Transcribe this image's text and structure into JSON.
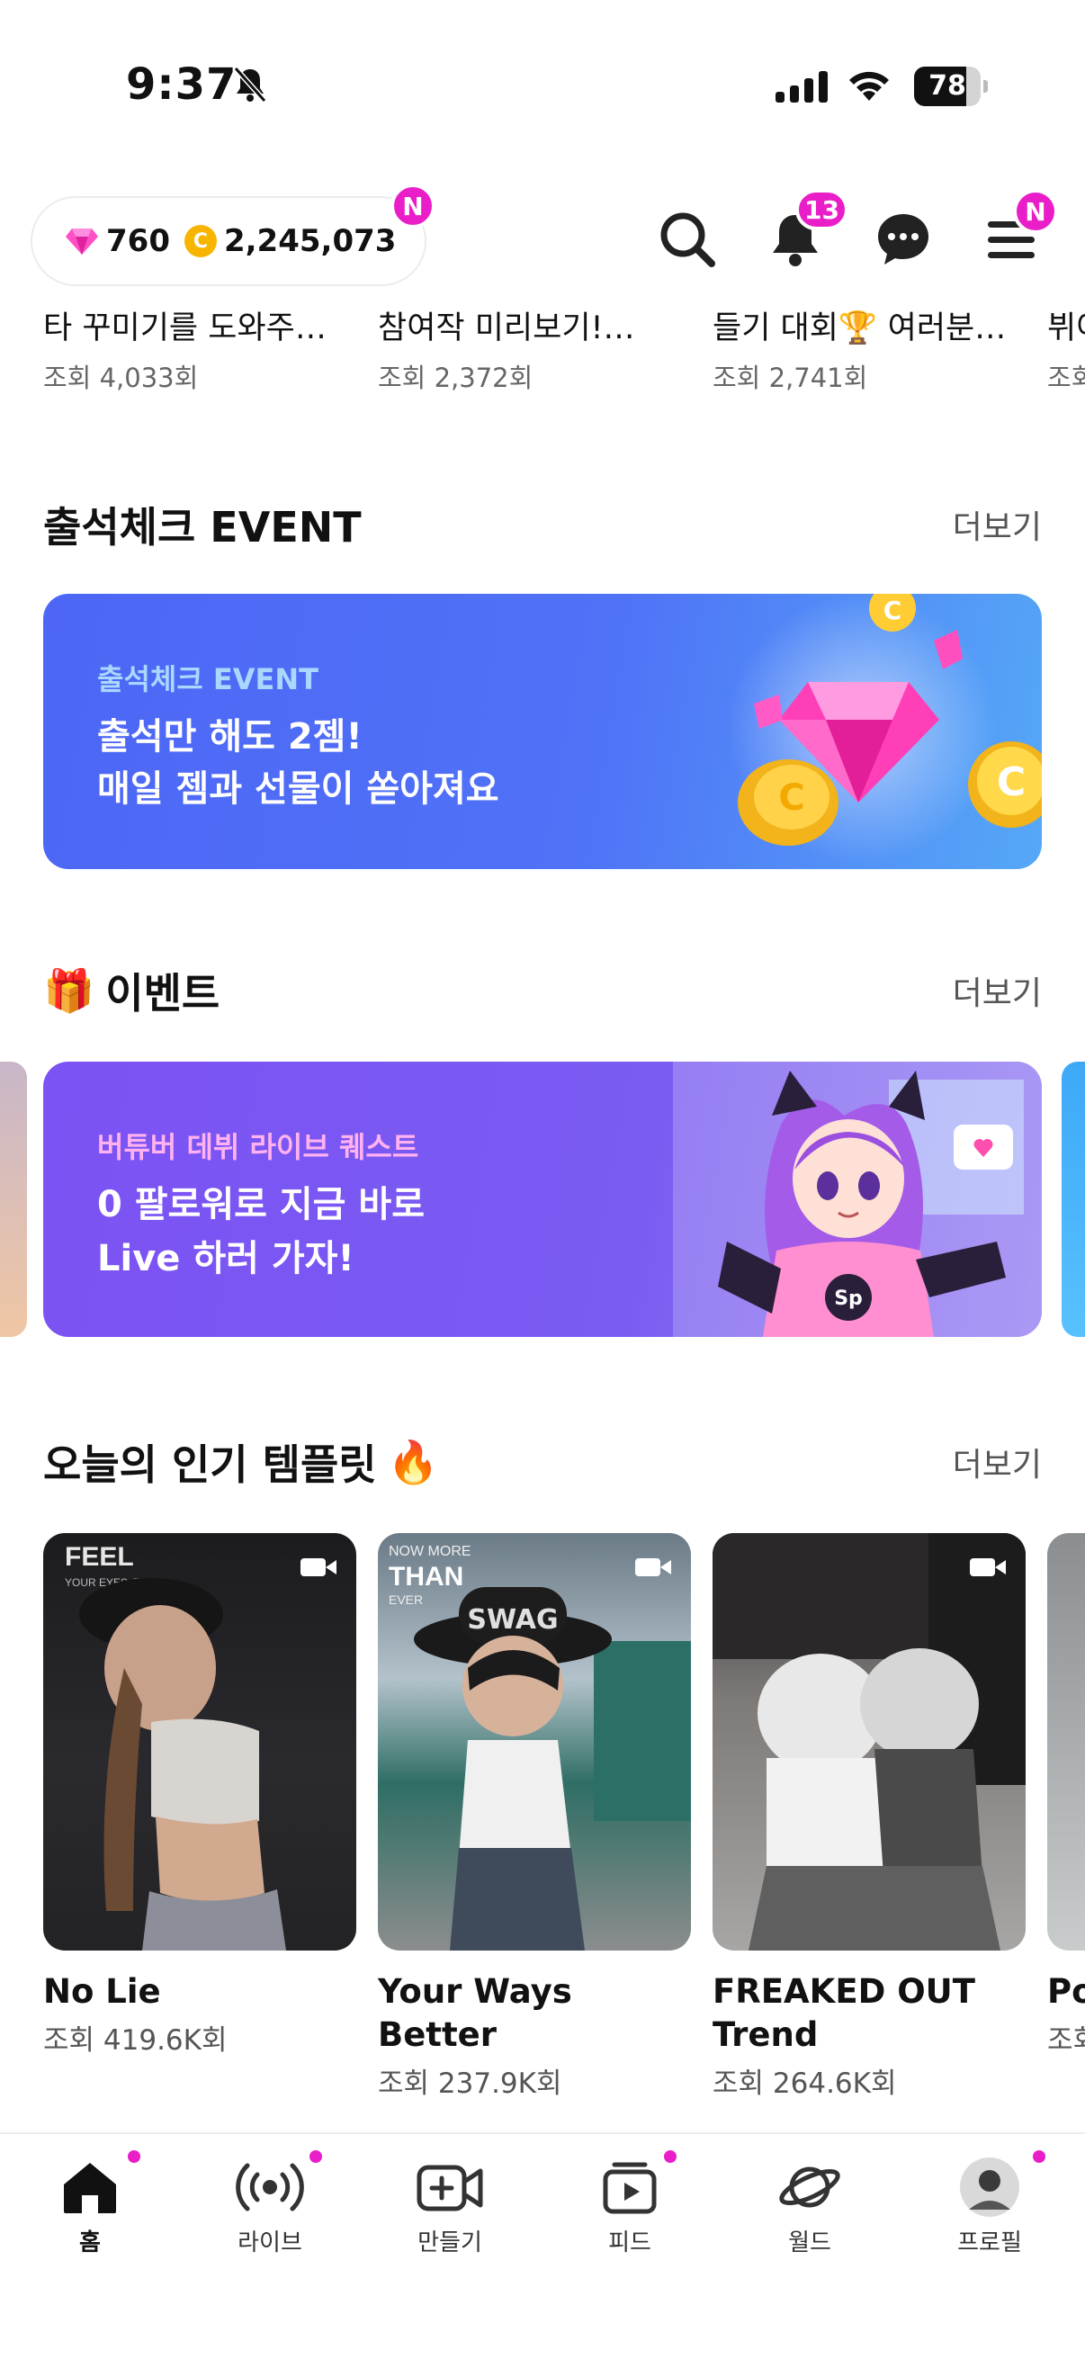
{
  "status_bar": {
    "time": "9:37",
    "battery": "78",
    "battery_level": 0.78
  },
  "header": {
    "gems": "760",
    "coins": "2,245,073",
    "coin_symbol": "C",
    "currency_badge": "N",
    "notification_count": "13",
    "menu_badge": "N"
  },
  "previous_row": [
    {
      "title": "타 꾸미기를 도와주…",
      "views": "조회 4,033회"
    },
    {
      "title": "참여작 미리보기!…",
      "views": "조회 2,372회"
    },
    {
      "title": "들기 대회🏆 여러분…",
      "views": "조회 2,741회"
    },
    {
      "title": "뷔어",
      "views": "조회"
    }
  ],
  "attendance": {
    "section_title": "출석체크 EVENT",
    "more": "더보기",
    "eyebrow": "출석체크 EVENT",
    "line1": "출석만 해도 2젬!",
    "line2": "매일 젬과 선물이 쏟아져요"
  },
  "events": {
    "icon": "🎁",
    "section_title": "이벤트",
    "more": "더보기",
    "eyebrow": "버튜버 데뷔 라이브 퀘스트",
    "line1": "0 팔로워로 지금 바로",
    "line2": "Live 하러 가자!",
    "sticker": "Sp"
  },
  "templates": {
    "section_title": "오늘의 인기 템플릿",
    "fire": "🔥",
    "more": "더보기",
    "items": [
      {
        "name": "No Lie",
        "views": "조회 419.6K회",
        "overlay1": "FEEL",
        "overlay2": "YOUR EYES, THEY"
      },
      {
        "name": "Your Ways Better",
        "views": "조회 237.9K회",
        "overlay1": "NOW MORE",
        "overlay2": "THAN",
        "overlay3": "EVER",
        "cap": "SWAG"
      },
      {
        "name": "FREAKED OUT Trend",
        "views": "조회 264.6K회"
      },
      {
        "name": "Po",
        "views": "조회"
      }
    ]
  },
  "tabs": [
    {
      "label": "홈",
      "icon": "home-icon"
    },
    {
      "label": "라이브",
      "icon": "live-broadcast-icon"
    },
    {
      "label": "만들기",
      "icon": "create-video-icon"
    },
    {
      "label": "피드",
      "icon": "feed-play-icon"
    },
    {
      "label": "월드",
      "icon": "planet-icon"
    },
    {
      "label": "프로필",
      "icon": "profile-avatar"
    }
  ],
  "colors": {
    "accent": "#e91ec8",
    "attendance_banner": "#4d66f5",
    "event_banner": "#7b52f3",
    "eyebrow_attendance": "#a9d8ff",
    "eyebrow_event": "#ffb2ef"
  }
}
